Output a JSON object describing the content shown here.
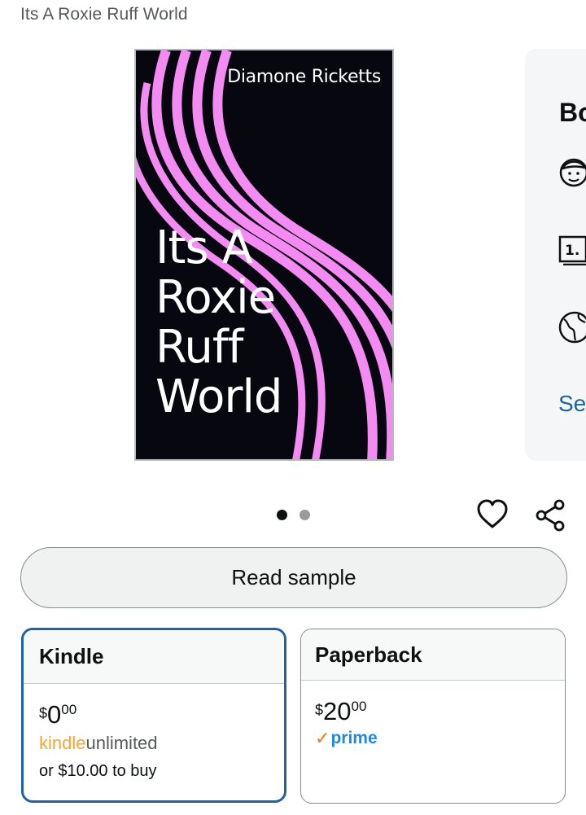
{
  "header": {
    "subtitle": "Its A Roxie Ruff World"
  },
  "cover": {
    "author": "Diamone Ricketts",
    "title_lines": [
      "Its A",
      "Roxie",
      "Ruff",
      "World"
    ],
    "background_color": "#06070f",
    "wave_color": "#f48bf2"
  },
  "details_panel": {
    "heading": "Bo",
    "icons": [
      "author-face-icon",
      "series-number-icon",
      "globe-icon"
    ],
    "link": "Se"
  },
  "carousel": {
    "total_pages": 2,
    "active_page": 1
  },
  "actions": {
    "wishlist_icon": "heart-icon",
    "share_icon": "share-icon"
  },
  "read_sample": {
    "label": "Read sample"
  },
  "formats": {
    "kindle": {
      "label": "Kindle",
      "currency": "$",
      "price_whole": "0",
      "price_fraction": "00",
      "ku_kindle": "kindle",
      "ku_unlimited": "unlimited",
      "buy_text": "or $10.00 to buy",
      "selected": true
    },
    "paperback": {
      "label": "Paperback",
      "currency": "$",
      "price_whole": "20",
      "price_fraction": "00",
      "prime_label": "prime",
      "selected": false
    }
  },
  "colors": {
    "accent": "#2162a1",
    "kindle_orange": "#f7a534",
    "prime_blue": "#1e88e5"
  }
}
